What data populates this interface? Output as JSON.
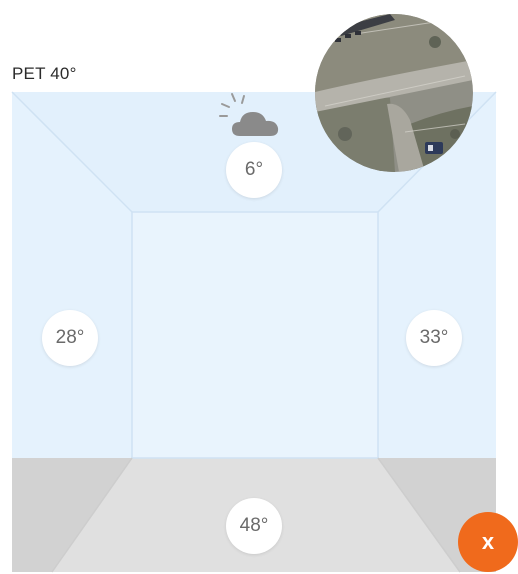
{
  "title": "PET 40°",
  "surfaces": {
    "ceiling": "6°",
    "left_wall": "28°",
    "right_wall": "33°",
    "floor": "48°"
  },
  "weather_icon": "sun-behind-cloud-icon",
  "photo": "aerial-view-photo",
  "close_button": {
    "label": "x",
    "icon": "close-icon"
  },
  "colors": {
    "walls": "#e6f3fd",
    "ceiling": "#e3f1fc",
    "floor": "#dedede",
    "floor_side": "#d4d4d4",
    "accent": "#f06a1c",
    "cloud": "#8a8a8a"
  }
}
